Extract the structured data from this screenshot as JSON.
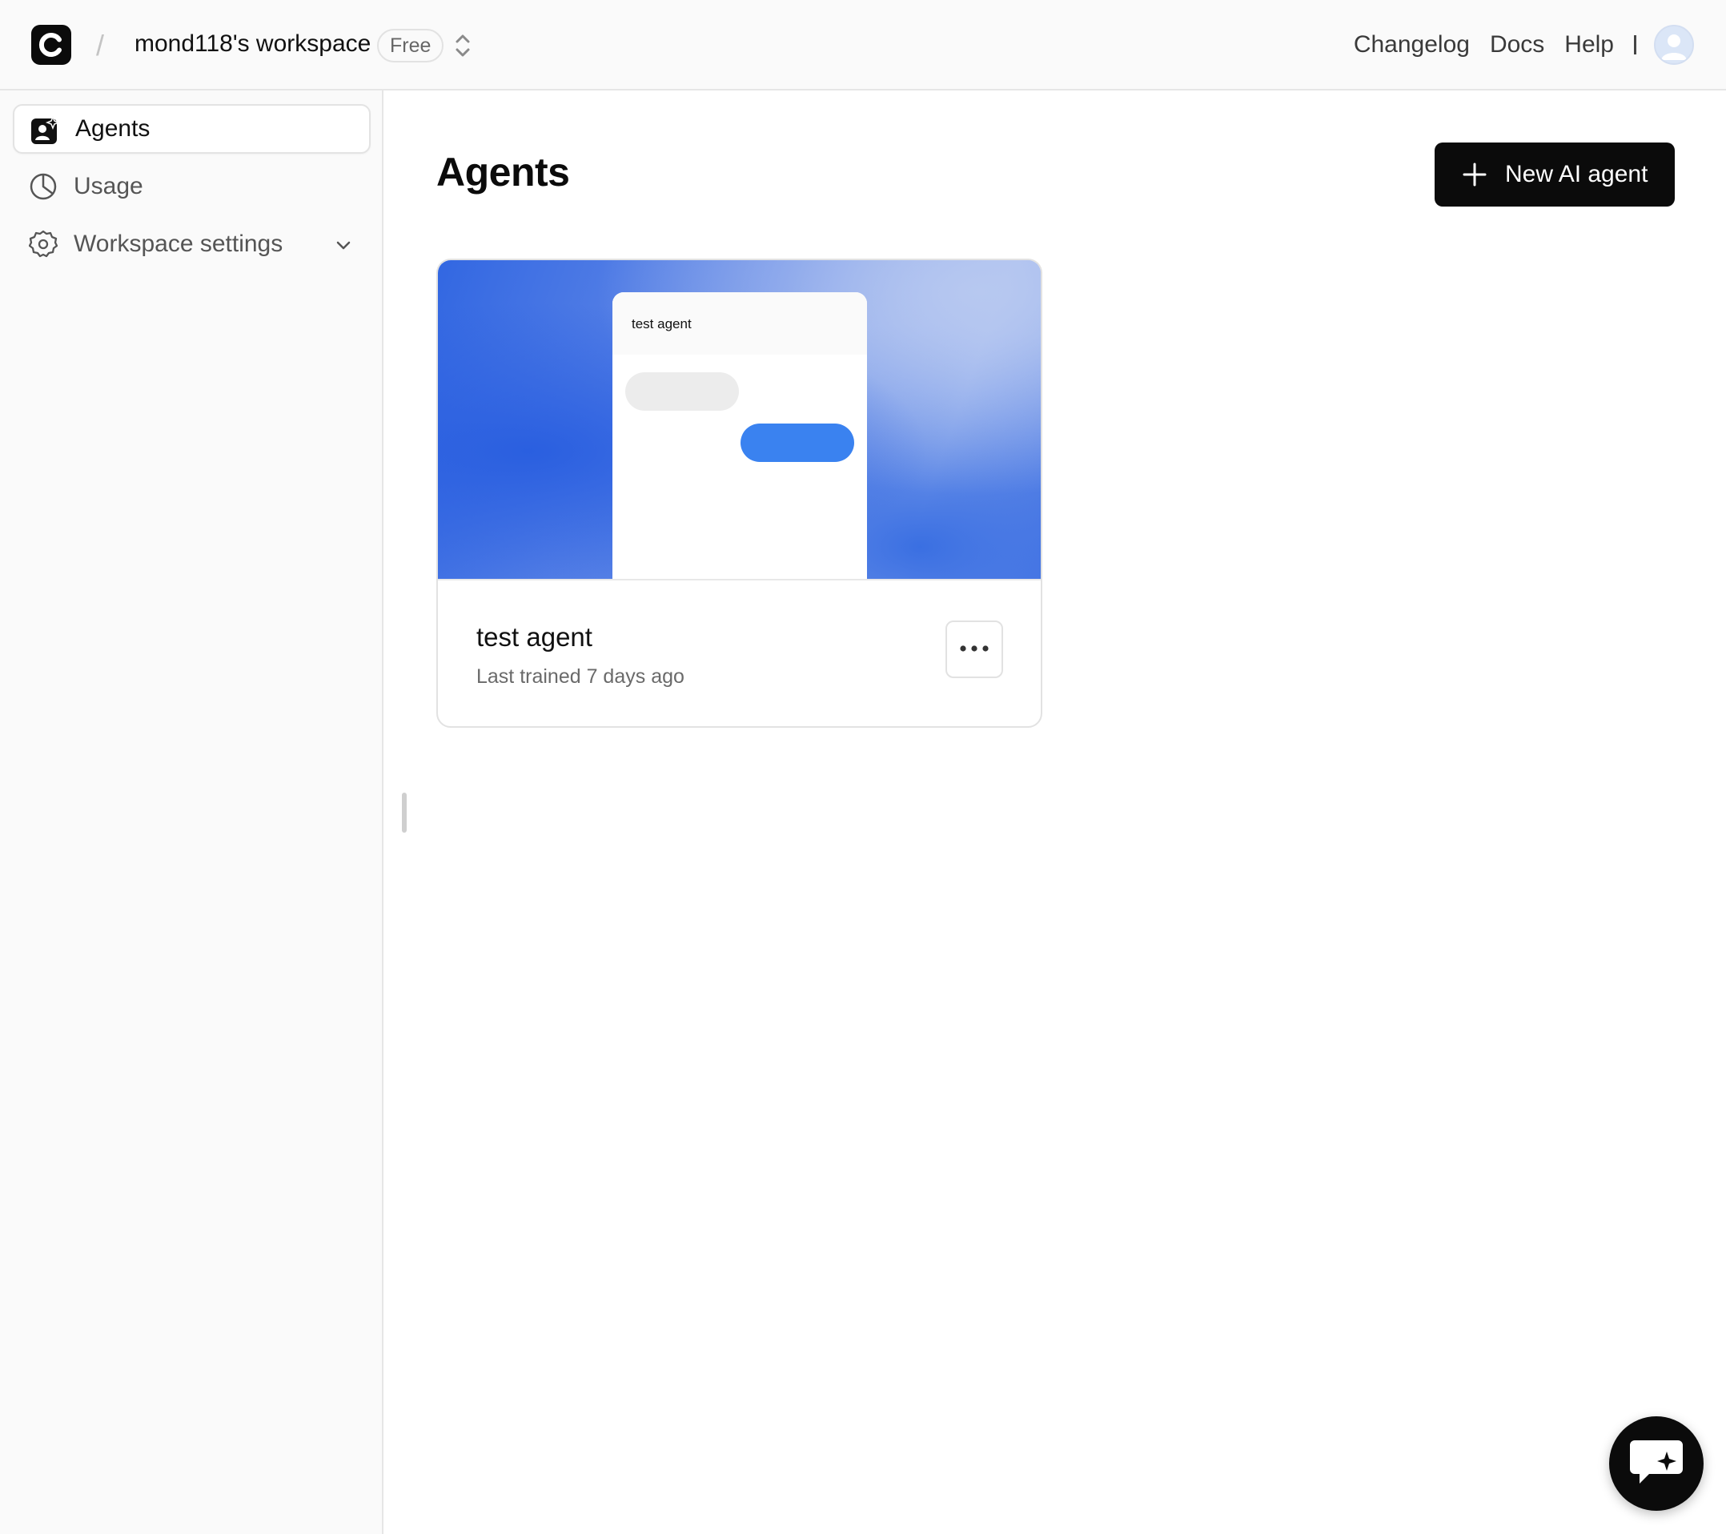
{
  "header": {
    "logo_letter": "C",
    "separator": "/",
    "workspace_name": "mond118's workspace",
    "plan_badge": "Free",
    "nav": {
      "changelog": "Changelog",
      "docs": "Docs",
      "help": "Help"
    }
  },
  "sidebar": {
    "items": [
      {
        "label": "Agents",
        "icon": "agent-icon",
        "active": true
      },
      {
        "label": "Usage",
        "icon": "pie-chart-icon",
        "active": false
      },
      {
        "label": "Workspace settings",
        "icon": "gear-icon",
        "active": false,
        "expandable": true
      }
    ]
  },
  "main": {
    "title": "Agents",
    "new_agent_button": "New AI agent",
    "agents": [
      {
        "name": "test agent",
        "preview_title": "test agent",
        "last_trained": "Last trained 7 days ago"
      }
    ]
  },
  "colors": {
    "primary": "#0b0b0b",
    "accent_blue": "#3a82f0",
    "sidebar_bg": "#fafafa"
  },
  "icons": [
    "logo-icon",
    "chevron-updown-icon",
    "avatar-icon",
    "agent-icon",
    "pie-chart-icon",
    "gear-icon",
    "chevron-down-icon",
    "plus-icon",
    "more-dots-icon",
    "chat-sparkle-icon"
  ]
}
